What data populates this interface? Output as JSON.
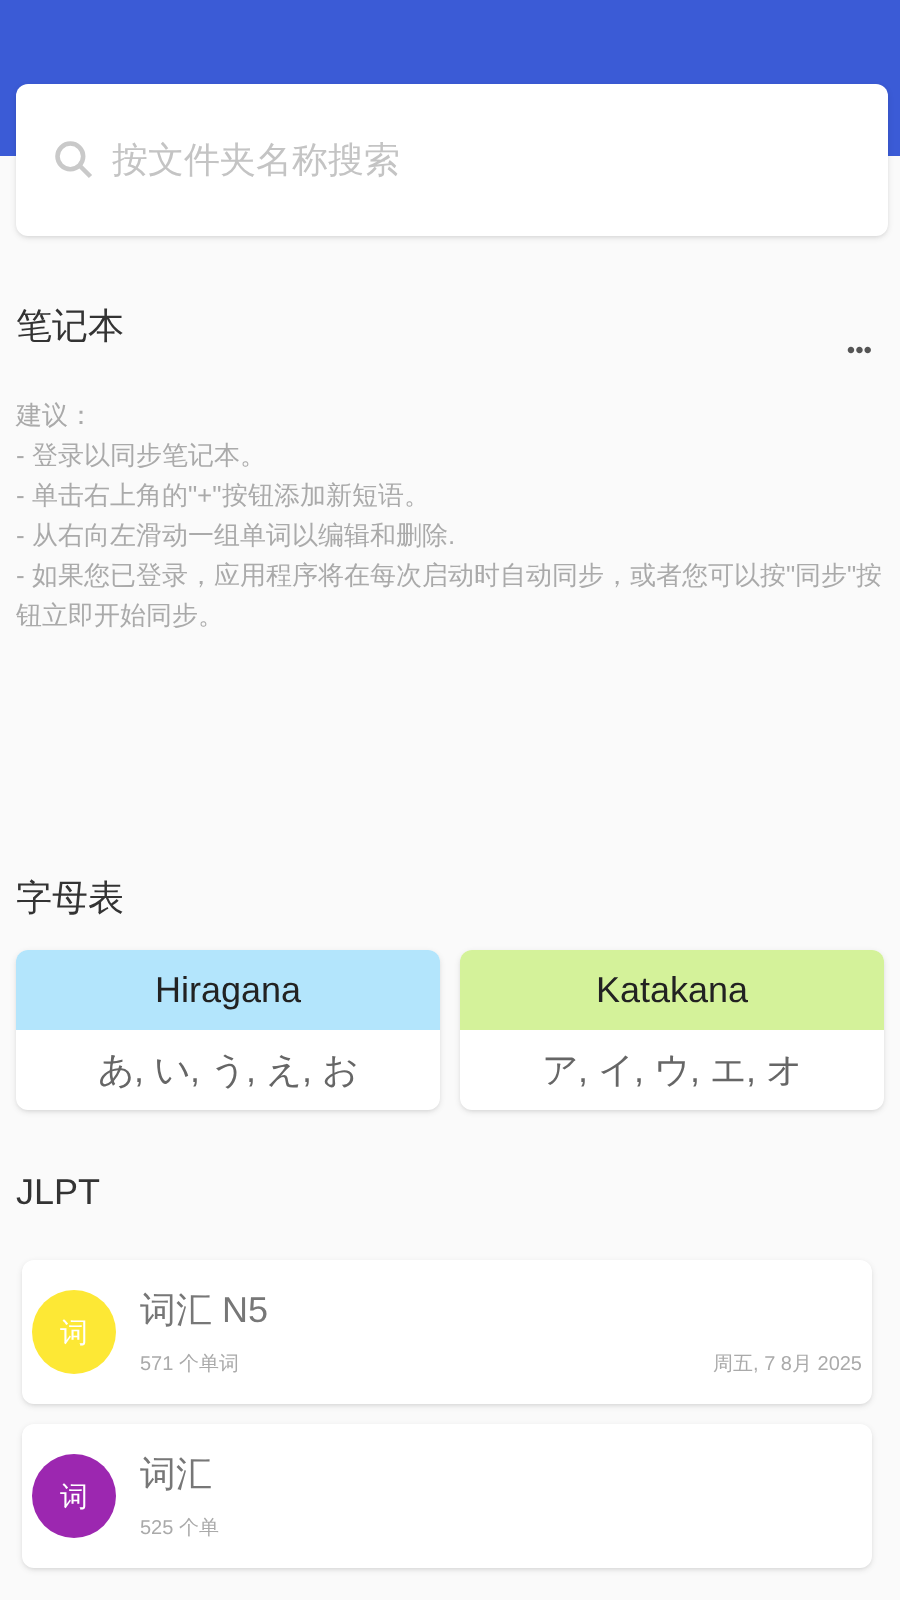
{
  "search": {
    "placeholder": "按文件夹名称搜索"
  },
  "notebook": {
    "title": "笔记本",
    "menu": "•••",
    "tips": [
      "建议：",
      "- 登录以同步笔记本。",
      "- 单击右上角的\"+\"按钮添加新短语。",
      "- 从右向左滑动一组单词以编辑和删除.",
      "- 如果您已登录，应用程序将在每次启动时自动同步，或者您可以按\"同步\"按钮立即开始同步。"
    ]
  },
  "alphabet": {
    "title": "字母表",
    "cards": [
      {
        "title": "Hiragana",
        "chars": "あ, い, う, え, お",
        "color": "#b3e5fc"
      },
      {
        "title": "Katakana",
        "chars": "ア, イ, ウ, エ, オ",
        "color": "#d4f29a"
      }
    ]
  },
  "jlpt": {
    "title": "JLPT",
    "items": [
      {
        "avatar": "词",
        "title": "词汇 N5",
        "count": "571 个单词",
        "date": "周五, 7 8月 2025",
        "color": "#fde835"
      },
      {
        "avatar": "词",
        "title": "词汇",
        "count": "525 个单",
        "color": "#9c27b0"
      }
    ]
  }
}
